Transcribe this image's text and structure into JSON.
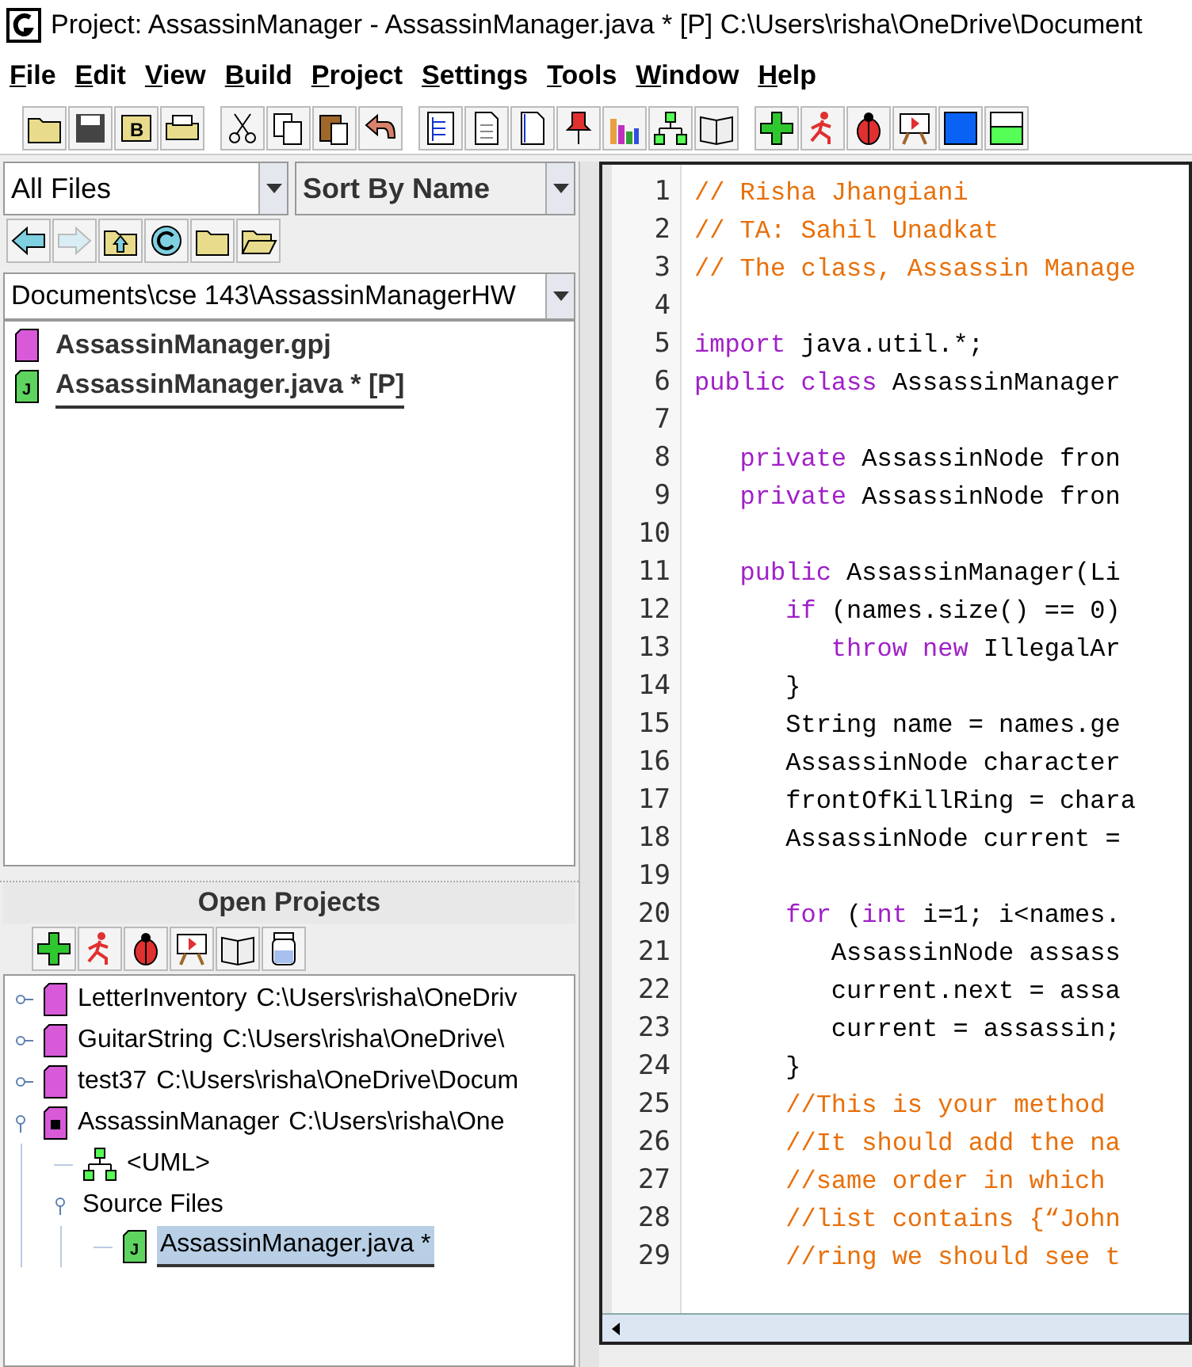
{
  "window": {
    "title": "Project: AssassinManager  - AssassinManager.java * [P]  C:\\Users\\risha\\OneDrive\\Document"
  },
  "menu": [
    "File",
    "Edit",
    "View",
    "Build",
    "Project",
    "Settings",
    "Tools",
    "Window",
    "Help"
  ],
  "toolbar": {
    "compile_icon_letter": "B"
  },
  "file_browser": {
    "filter": "All Files",
    "sort": "Sort By Name",
    "path": "Documents\\cse 143\\AssassinManagerHW",
    "files": [
      {
        "name": "AssassinManager.gpj",
        "kind": "project",
        "active": false
      },
      {
        "name": "AssassinManager.java * [P]",
        "kind": "java",
        "icon_letter": "J",
        "active": true
      }
    ]
  },
  "open_projects": {
    "title": "Open Projects",
    "items": [
      {
        "name": "LetterInventory",
        "path": "C:\\Users\\risha\\OneDriv",
        "kind": "project",
        "expanded": false,
        "selected": false
      },
      {
        "name": "GuitarString",
        "path": "C:\\Users\\risha\\OneDrive\\",
        "kind": "project",
        "expanded": false,
        "selected": false
      },
      {
        "name": "test37",
        "path": "C:\\Users\\risha\\OneDrive\\Docum",
        "kind": "project",
        "expanded": false,
        "selected": false
      },
      {
        "name": "AssassinManager",
        "path": "C:\\Users\\risha\\One",
        "kind": "project-open",
        "expanded": true,
        "selected": false,
        "children": [
          {
            "name": "<UML>",
            "kind": "uml",
            "selected": false
          },
          {
            "name": "Source Files",
            "kind": "folder",
            "expanded": true,
            "selected": false,
            "children": [
              {
                "name": "AssassinManager.java *",
                "kind": "java",
                "icon_letter": "J",
                "selected": true
              }
            ]
          }
        ]
      }
    ]
  },
  "editor": {
    "lines": [
      {
        "number": "1",
        "tokens": [
          {
            "kind": "comment",
            "text": "// Risha Jhangiani"
          }
        ]
      },
      {
        "number": "2",
        "tokens": [
          {
            "kind": "comment",
            "text": "// TA: Sahil Unadkat"
          }
        ]
      },
      {
        "number": "3",
        "tokens": [
          {
            "kind": "comment",
            "text": "// The class, Assassin Manage"
          }
        ]
      },
      {
        "number": "4"
      },
      {
        "number": "5",
        "tokens": [
          {
            "kind": "keyword",
            "text": "import"
          },
          {
            "kind": "plain",
            "text": " java.util.*;"
          }
        ]
      },
      {
        "number": "6",
        "tokens": [
          {
            "kind": "keyword",
            "text": "public class"
          },
          {
            "kind": "plain",
            "text": " AssassinManager"
          }
        ]
      },
      {
        "number": "7"
      },
      {
        "number": "8",
        "tokens": [
          {
            "kind": "keyword",
            "text": "   private"
          },
          {
            "kind": "plain",
            "text": " AssassinNode fron"
          }
        ]
      },
      {
        "number": "9",
        "tokens": [
          {
            "kind": "keyword",
            "text": "   private"
          },
          {
            "kind": "plain",
            "text": " AssassinNode fron"
          }
        ]
      },
      {
        "number": "10"
      },
      {
        "number": "11",
        "tokens": [
          {
            "kind": "keyword",
            "text": "   public"
          },
          {
            "kind": "plain",
            "text": " AssassinManager(Li"
          }
        ]
      },
      {
        "number": "12",
        "tokens": [
          {
            "kind": "keyword",
            "text": "      if"
          },
          {
            "kind": "plain",
            "text": " (names.size() == 0)"
          }
        ]
      },
      {
        "number": "13",
        "tokens": [
          {
            "kind": "keyword",
            "text": "         throw new"
          },
          {
            "kind": "plain",
            "text": " IllegalAr"
          }
        ]
      },
      {
        "number": "14",
        "tokens": [
          {
            "kind": "plain",
            "text": "      }"
          }
        ]
      },
      {
        "number": "15",
        "tokens": [
          {
            "kind": "plain",
            "text": "      String name = names.ge"
          }
        ]
      },
      {
        "number": "16",
        "tokens": [
          {
            "kind": "plain",
            "text": "      AssassinNode character"
          }
        ]
      },
      {
        "number": "17",
        "tokens": [
          {
            "kind": "plain",
            "text": "      frontOfKillRing = chara"
          }
        ]
      },
      {
        "number": "18",
        "tokens": [
          {
            "kind": "plain",
            "text": "      AssassinNode current ="
          }
        ]
      },
      {
        "number": "19"
      },
      {
        "number": "20",
        "tokens": [
          {
            "kind": "keyword",
            "text": "      for"
          },
          {
            "kind": "plain",
            "text": " ("
          },
          {
            "kind": "keyword",
            "text": "int"
          },
          {
            "kind": "plain",
            "text": " i=1; i<names."
          }
        ]
      },
      {
        "number": "21",
        "tokens": [
          {
            "kind": "plain",
            "text": "         AssassinNode assass"
          }
        ]
      },
      {
        "number": "22",
        "tokens": [
          {
            "kind": "plain",
            "text": "         current.next = assa"
          }
        ]
      },
      {
        "number": "23",
        "tokens": [
          {
            "kind": "plain",
            "text": "         current = assassin;"
          }
        ]
      },
      {
        "number": "24",
        "tokens": [
          {
            "kind": "plain",
            "text": "      }"
          }
        ]
      },
      {
        "number": "25",
        "tokens": [
          {
            "kind": "comment",
            "text": "      //This is your method"
          }
        ]
      },
      {
        "number": "26",
        "tokens": [
          {
            "kind": "comment",
            "text": "      //It should add the na"
          }
        ]
      },
      {
        "number": "27",
        "tokens": [
          {
            "kind": "comment",
            "text": "      //same order in which"
          }
        ]
      },
      {
        "number": "28",
        "tokens": [
          {
            "kind": "comment",
            "text": "      //list contains {“John"
          }
        ]
      },
      {
        "number": "29",
        "tokens": [
          {
            "kind": "comment",
            "text": "      //ring we should see t"
          }
        ]
      }
    ]
  }
}
